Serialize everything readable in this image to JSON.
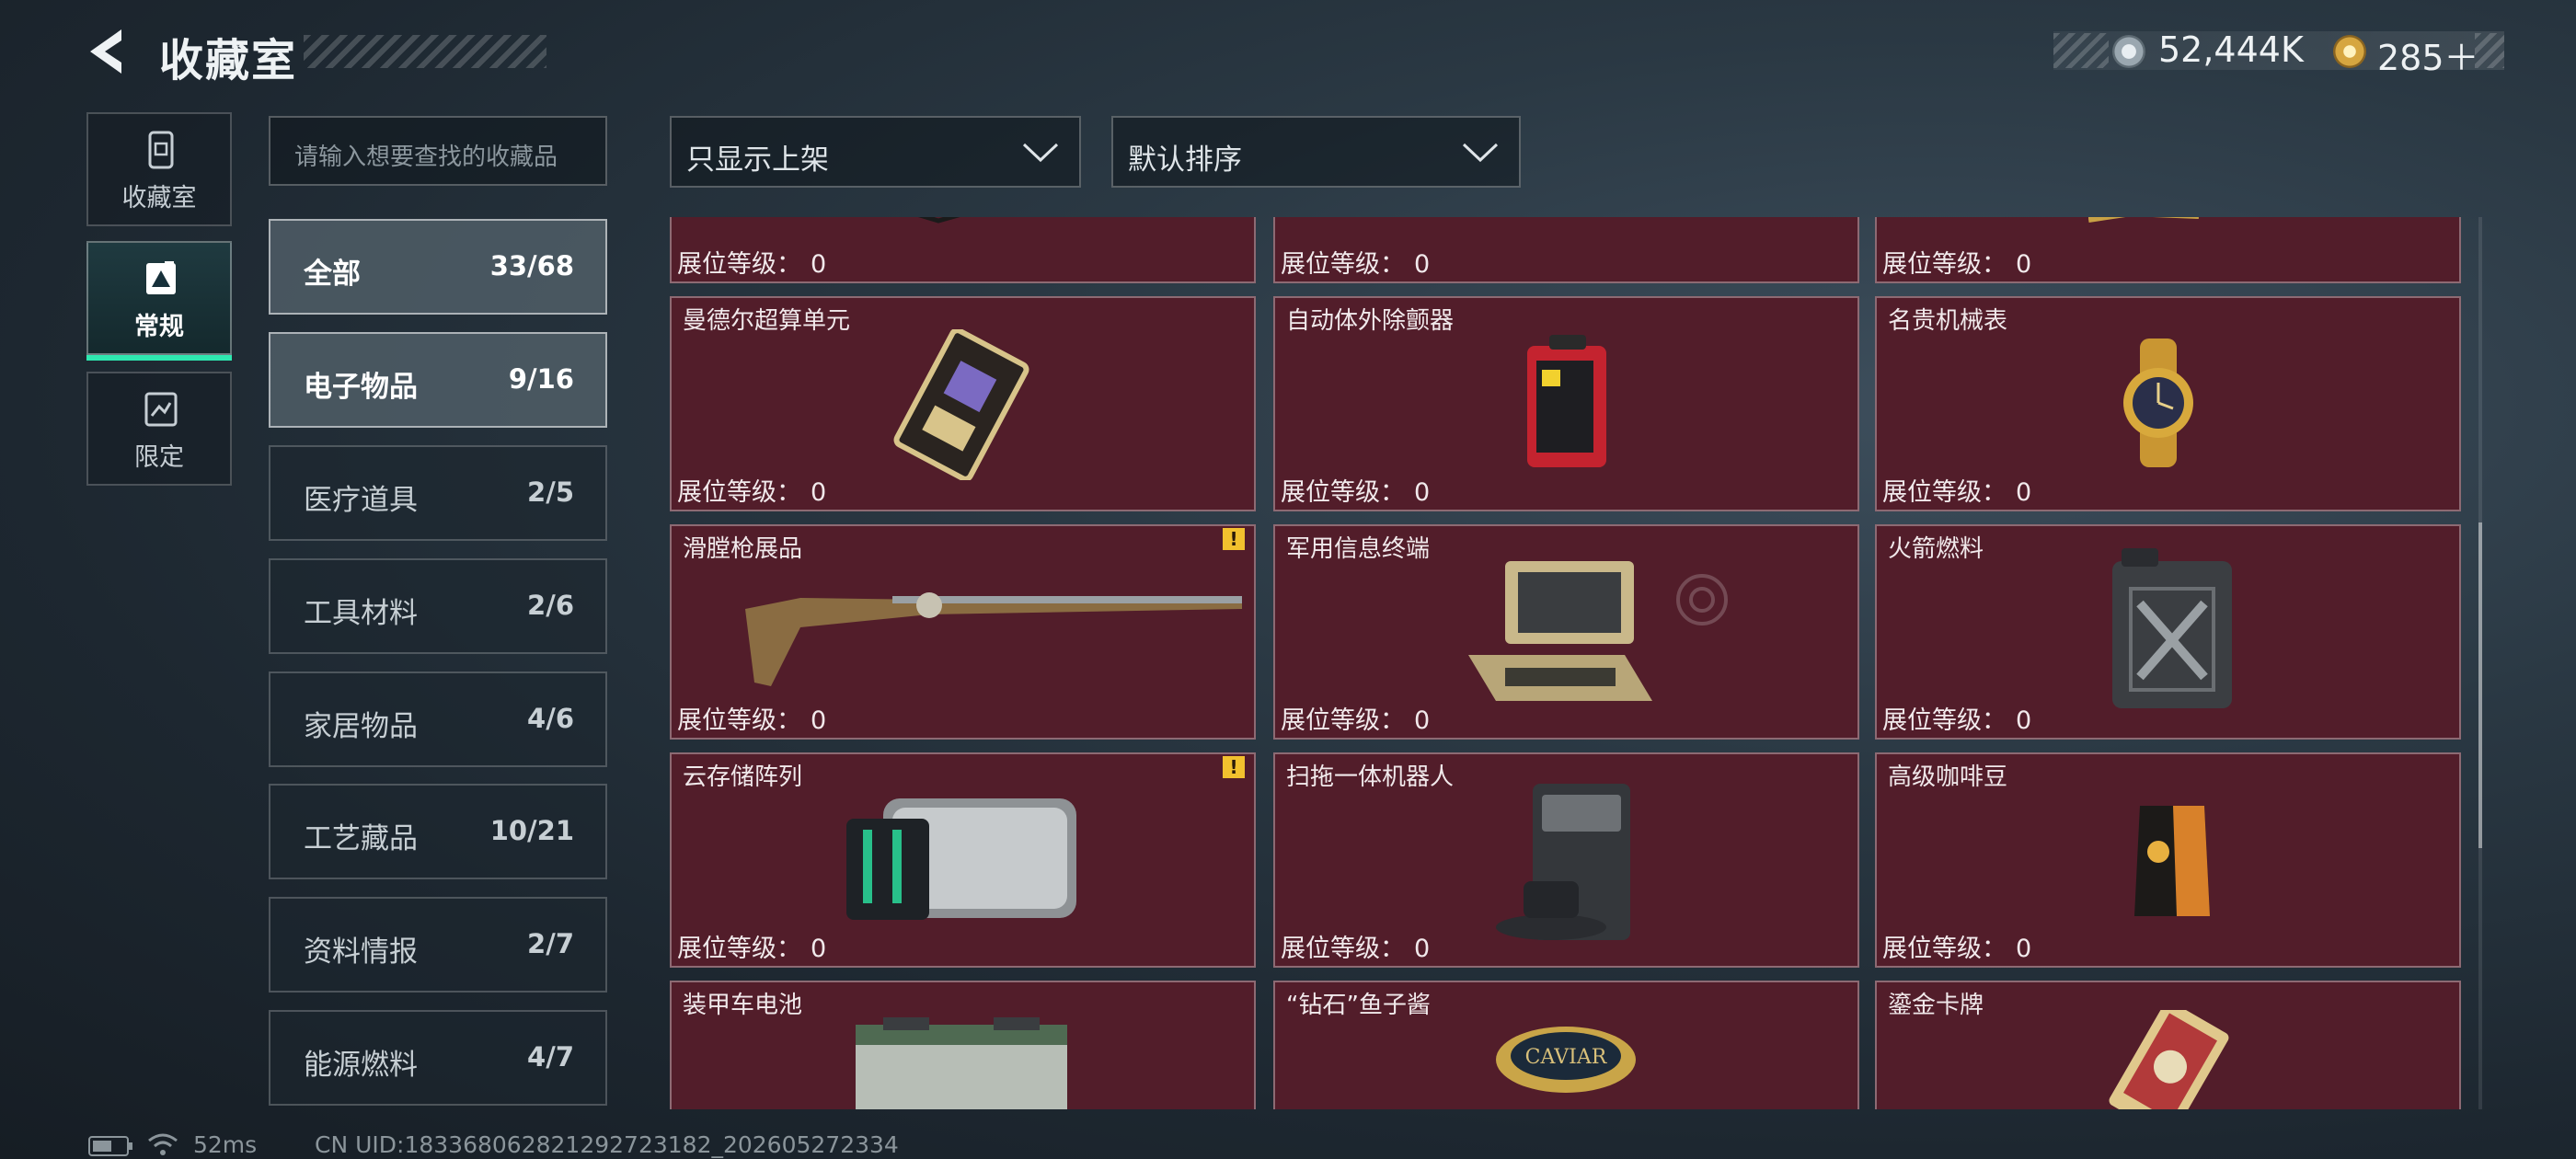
{
  "header": {
    "title": "收藏室",
    "currency": [
      {
        "icon": "silver-coin-icon",
        "value": "52,444K"
      },
      {
        "icon": "gold-coin-icon",
        "value": "285＋"
      }
    ]
  },
  "nav": [
    {
      "label": "收藏室",
      "icon": "collection-icon",
      "active": false
    },
    {
      "label": "常规",
      "icon": "regular-icon",
      "active": true
    },
    {
      "label": "限定",
      "icon": "limited-icon",
      "active": false
    }
  ],
  "search": {
    "placeholder": "请输入想要查找的收藏品"
  },
  "filters": {
    "display": "只显示上架",
    "sort": "默认排序"
  },
  "categories": [
    {
      "name": "全部",
      "count": "33/68",
      "selected": true
    },
    {
      "name": "电子物品",
      "count": "9/16",
      "selected": true
    },
    {
      "name": "医疗道具",
      "count": "2/5"
    },
    {
      "name": "工具材料",
      "count": "2/6"
    },
    {
      "name": "家居物品",
      "count": "4/6"
    },
    {
      "name": "工艺藏品",
      "count": "10/21"
    },
    {
      "name": "资料情报",
      "count": "2/7"
    },
    {
      "name": "能源燃料",
      "count": "4/7"
    }
  ],
  "level_label": "展位等级：",
  "items": [
    {
      "name": "",
      "level": "0"
    },
    {
      "name": "",
      "level": "0"
    },
    {
      "name": "",
      "level": "0"
    },
    {
      "name": "曼德尔超算单元",
      "level": "0"
    },
    {
      "name": "自动体外除颤器",
      "level": "0"
    },
    {
      "name": "名贵机械表",
      "level": "0"
    },
    {
      "name": "滑膛枪展品",
      "level": "0",
      "alert": "!"
    },
    {
      "name": "军用信息终端",
      "level": "0"
    },
    {
      "name": "火箭燃料",
      "level": "0"
    },
    {
      "name": "云存储阵列",
      "level": "0",
      "alert": "!"
    },
    {
      "name": "扫拖一体机器人",
      "level": "0"
    },
    {
      "name": "高级咖啡豆",
      "level": "0"
    },
    {
      "name": "装甲车电池",
      "level": ""
    },
    {
      "name": "“钻石”鱼子酱",
      "level": ""
    },
    {
      "name": "鎏金卡牌",
      "level": ""
    }
  ],
  "footer": {
    "ping": "52ms",
    "uid": "CN UID:18336806282129272​3182_202605272334"
  }
}
